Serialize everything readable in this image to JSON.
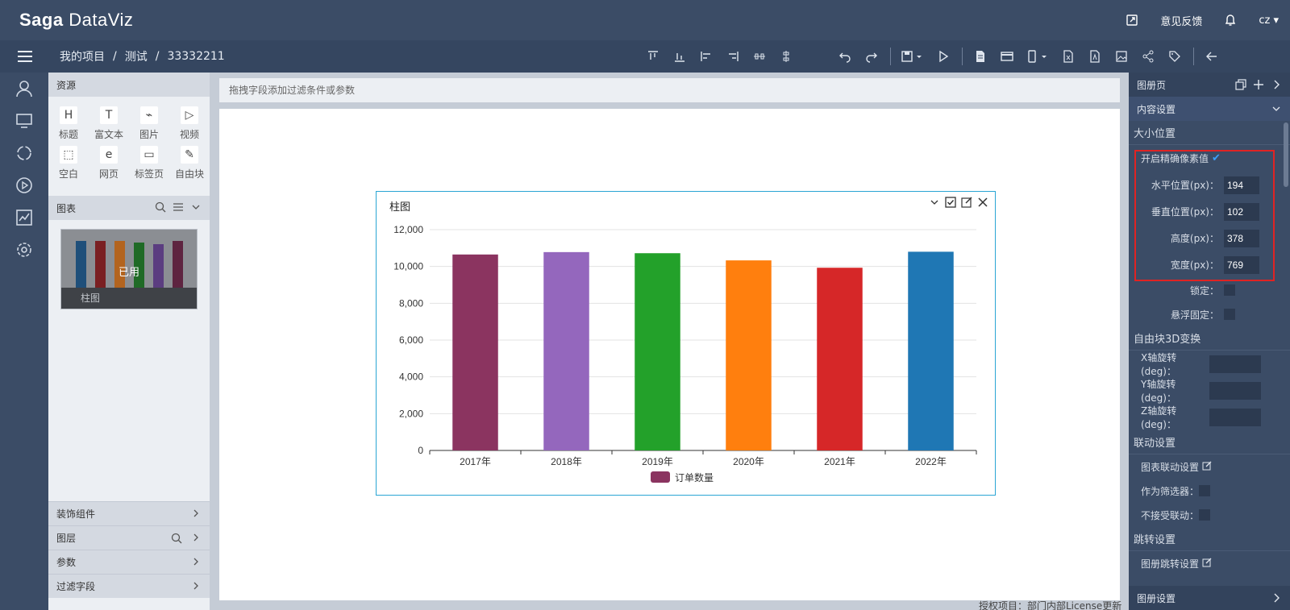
{
  "app": {
    "logo_prefix": "Sa",
    "logo_mid": "ga",
    "logo_suffix": "DataViz"
  },
  "topbar": {
    "feedback": "意见反馈",
    "user": "cz"
  },
  "breadcrumb": [
    "我的项目",
    "/",
    "测试",
    "/",
    "33332211"
  ],
  "resources": {
    "title": "资源",
    "items": [
      "标题",
      "富文本",
      "图片",
      "视频",
      "空白",
      "网页",
      "标签页",
      "自由块"
    ],
    "icon_glyphs": [
      "H",
      "T",
      "⌁",
      "▷",
      "⬚",
      "e",
      "▭",
      "✎"
    ]
  },
  "charts_section": {
    "title": "图表",
    "thumb_used": "已用",
    "thumb_caption": "柱图"
  },
  "bottom_sections": [
    "装饰组件",
    "图层",
    "参数",
    "过滤字段"
  ],
  "filterbar": {
    "placeholder": "拖拽字段添加过滤条件或参数"
  },
  "footnote": "授权项目：部门内部License更新",
  "widget": {
    "title": "柱图"
  },
  "chart_data": {
    "type": "bar",
    "title": "柱图",
    "categories": [
      "2017年",
      "2018年",
      "2019年",
      "2020年",
      "2021年",
      "2022年"
    ],
    "series": [
      {
        "name": "订单数量",
        "values": [
          10650,
          10780,
          10720,
          10330,
          9930,
          10800
        ]
      }
    ],
    "bar_colors": [
      "#8b3460",
      "#9467bd",
      "#23a12a",
      "#ff7f0e",
      "#d62728",
      "#1f77b4"
    ],
    "ylim": [
      0,
      12000
    ],
    "yticks": [
      "0",
      "2,000",
      "4,000",
      "6,000",
      "8,000",
      "10,000",
      "12,000"
    ],
    "grid": true,
    "legend": "bottom-center"
  },
  "right_panel": {
    "title": "图册页",
    "content_settings": "内容设置",
    "size_position": "大小位置",
    "precise_pixel": "开启精确像素值",
    "h_pos_label": "水平位置(px)：",
    "h_pos": "194",
    "v_pos_label": "垂直位置(px)：",
    "v_pos": "102",
    "height_label": "高度(px)：",
    "height": "378",
    "width_label": "宽度(px)：",
    "width": "769",
    "lock_label": "锁定：",
    "float_label": "悬浮固定：",
    "transform3d": "自由块3D变换",
    "x_rot_label": "X轴旋转(deg)：",
    "y_rot_label": "Y轴旋转(deg)：",
    "z_rot_label": "Z轴旋转(deg)：",
    "linkage": "联动设置",
    "chart_linkage": "图表联动设置",
    "as_filter": "作为筛选器：",
    "no_linkage": "不接受联动：",
    "jump": "跳转设置",
    "jump_setting": "图册跳转设置",
    "footer": "图册设置"
  },
  "colors": {
    "header_bg": "#3b4c66",
    "accent": "#2aa5d4",
    "highlight": "#e02323"
  }
}
